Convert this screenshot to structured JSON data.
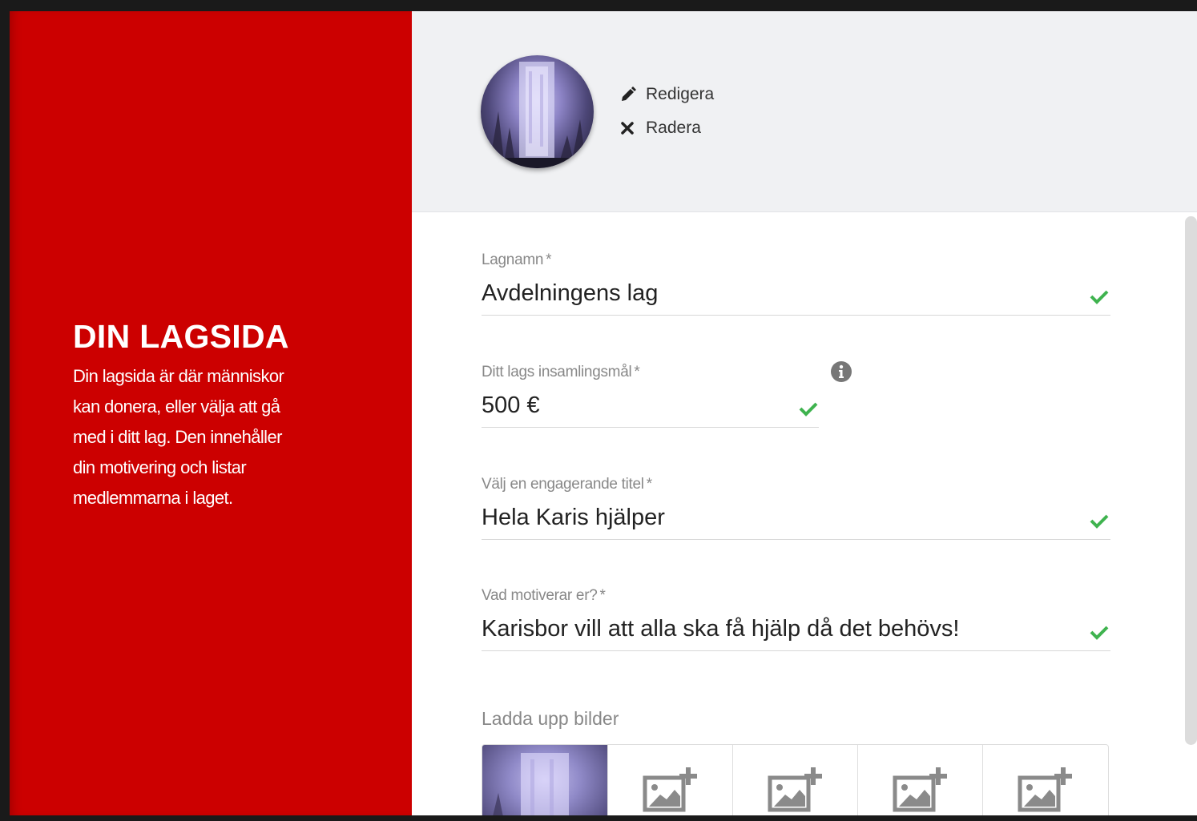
{
  "sidebar": {
    "title": "DIN LAGSIDA",
    "lines": [
      "Din lagsida är där människor",
      "kan donera, eller välja att gå",
      "med i ditt lag. Den innehåller",
      "din motivering och listar",
      "medlemmarna i laget."
    ]
  },
  "header": {
    "edit_label": "Redigera",
    "delete_label": "Radera"
  },
  "form": {
    "team_name": {
      "label": "Lagnamn",
      "required": "*",
      "value": "Avdelningens lag"
    },
    "goal": {
      "label": "Ditt lags insamlingsmål",
      "required": "*",
      "value": "500 €"
    },
    "title": {
      "label": "Välj en engagerande titel",
      "required": "*",
      "value": "Hela Karis hjälper"
    },
    "motivation": {
      "label": "Vad motiverar er?",
      "required": "*",
      "value": "Karisbor vill att alla ska få hjälp då det behövs!"
    },
    "upload_label": "Ladda upp bilder"
  },
  "icons": {
    "edit": "pencil-icon",
    "delete": "close-icon",
    "valid": "check-icon",
    "info": "info-icon",
    "add_image": "add-image-icon"
  },
  "colors": {
    "brand_red": "#cc0000",
    "check_green": "#3fb34f",
    "header_bg": "#f0f1f3"
  }
}
